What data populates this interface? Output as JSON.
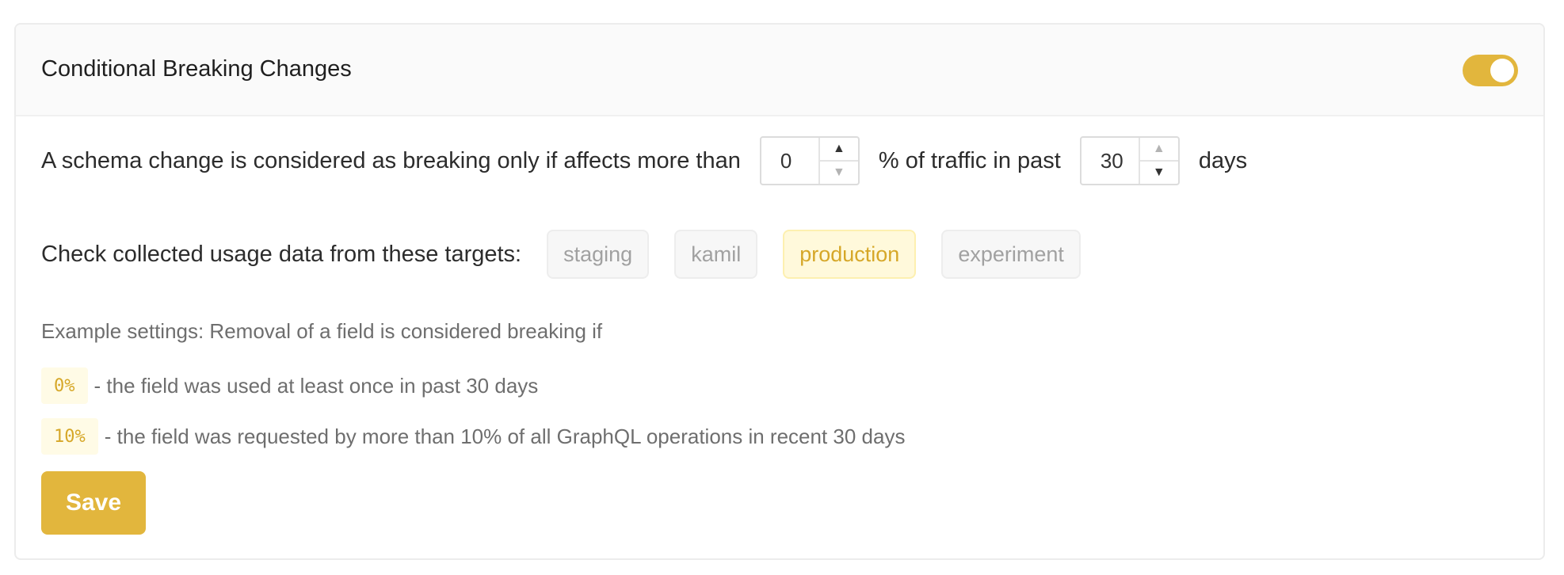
{
  "header": {
    "title": "Conditional Breaking Changes",
    "toggle_on": true,
    "accent_color": "#e2b63d"
  },
  "condition": {
    "text_before": "A schema change is considered as breaking only if affects more than",
    "percentage_value": "0",
    "text_middle": "% of traffic in past",
    "days_value": "30",
    "text_after": "days"
  },
  "targets": {
    "label": "Check collected usage data from these targets:",
    "items": [
      {
        "label": "staging",
        "selected": false
      },
      {
        "label": "kamil",
        "selected": false
      },
      {
        "label": "production",
        "selected": true
      },
      {
        "label": "experiment",
        "selected": false
      }
    ]
  },
  "examples": {
    "title": "Example settings: Removal of a field is considered breaking if",
    "items": [
      {
        "badge": "0%",
        "text": "- the field was used at least once in past 30 days"
      },
      {
        "badge": "10%",
        "text": "- the field was requested by more than 10% of all GraphQL operations in recent 30 days"
      }
    ]
  },
  "actions": {
    "save_label": "Save"
  }
}
